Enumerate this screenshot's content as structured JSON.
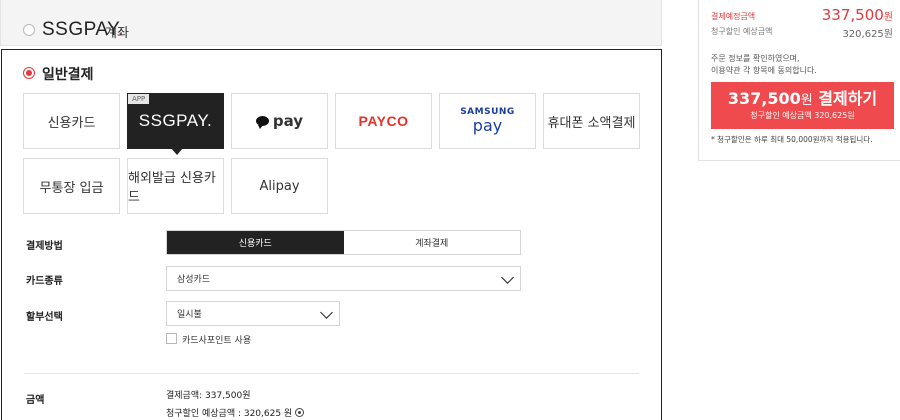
{
  "top": {
    "logo_text": "SSGPAY",
    "logo_mark": ".",
    "label": "계좌"
  },
  "general": {
    "title": "일반결제",
    "methods": [
      {
        "label": "신용카드"
      },
      {
        "label": "SSGPAY.",
        "badge": "APP"
      },
      {
        "label": "pay"
      },
      {
        "label": "PAYCO"
      },
      {
        "label_line1": "SAMSUNG",
        "label_line2": "pay"
      },
      {
        "label": "휴대폰 소액결제"
      },
      {
        "label": "무통장 입금"
      },
      {
        "label": "해외발급 신용카드"
      },
      {
        "label": "Alipay"
      }
    ]
  },
  "form": {
    "payment_method_label": "결제방법",
    "payment_options": [
      "신용카드",
      "계좌결제"
    ],
    "card_type_label": "카드종류",
    "card_type_value": "삼성카드",
    "installment_label": "할부선택",
    "installment_value": "일시불",
    "card_point_label": "카드사포인트 사용",
    "amount_label": "금액",
    "amount_line1": "결제금액: 337,500원",
    "amount_line2": "청구할인 예상금액 : 320,625 원"
  },
  "summary": {
    "expected_label": "결제예정금액",
    "expected_value": "337,500",
    "expected_unit": "원",
    "discount_label": "청구할인 예상금액",
    "discount_value": "320,625원",
    "agree_line1": "주문 정보를 확인하였으며,",
    "agree_line2": "이용약관 각 항목에 동의합니다.",
    "pay_amount": "337,500",
    "pay_unit": "원",
    "pay_action": "결제하기",
    "pay_sub": "청구할인 예상금액  320,625원",
    "note": "* 청구할인은 하루 최대 50,000원까지 적용됩니다."
  },
  "colors": {
    "accent": "#e5383b",
    "button": "#ef4b4f",
    "dark": "#222222"
  }
}
